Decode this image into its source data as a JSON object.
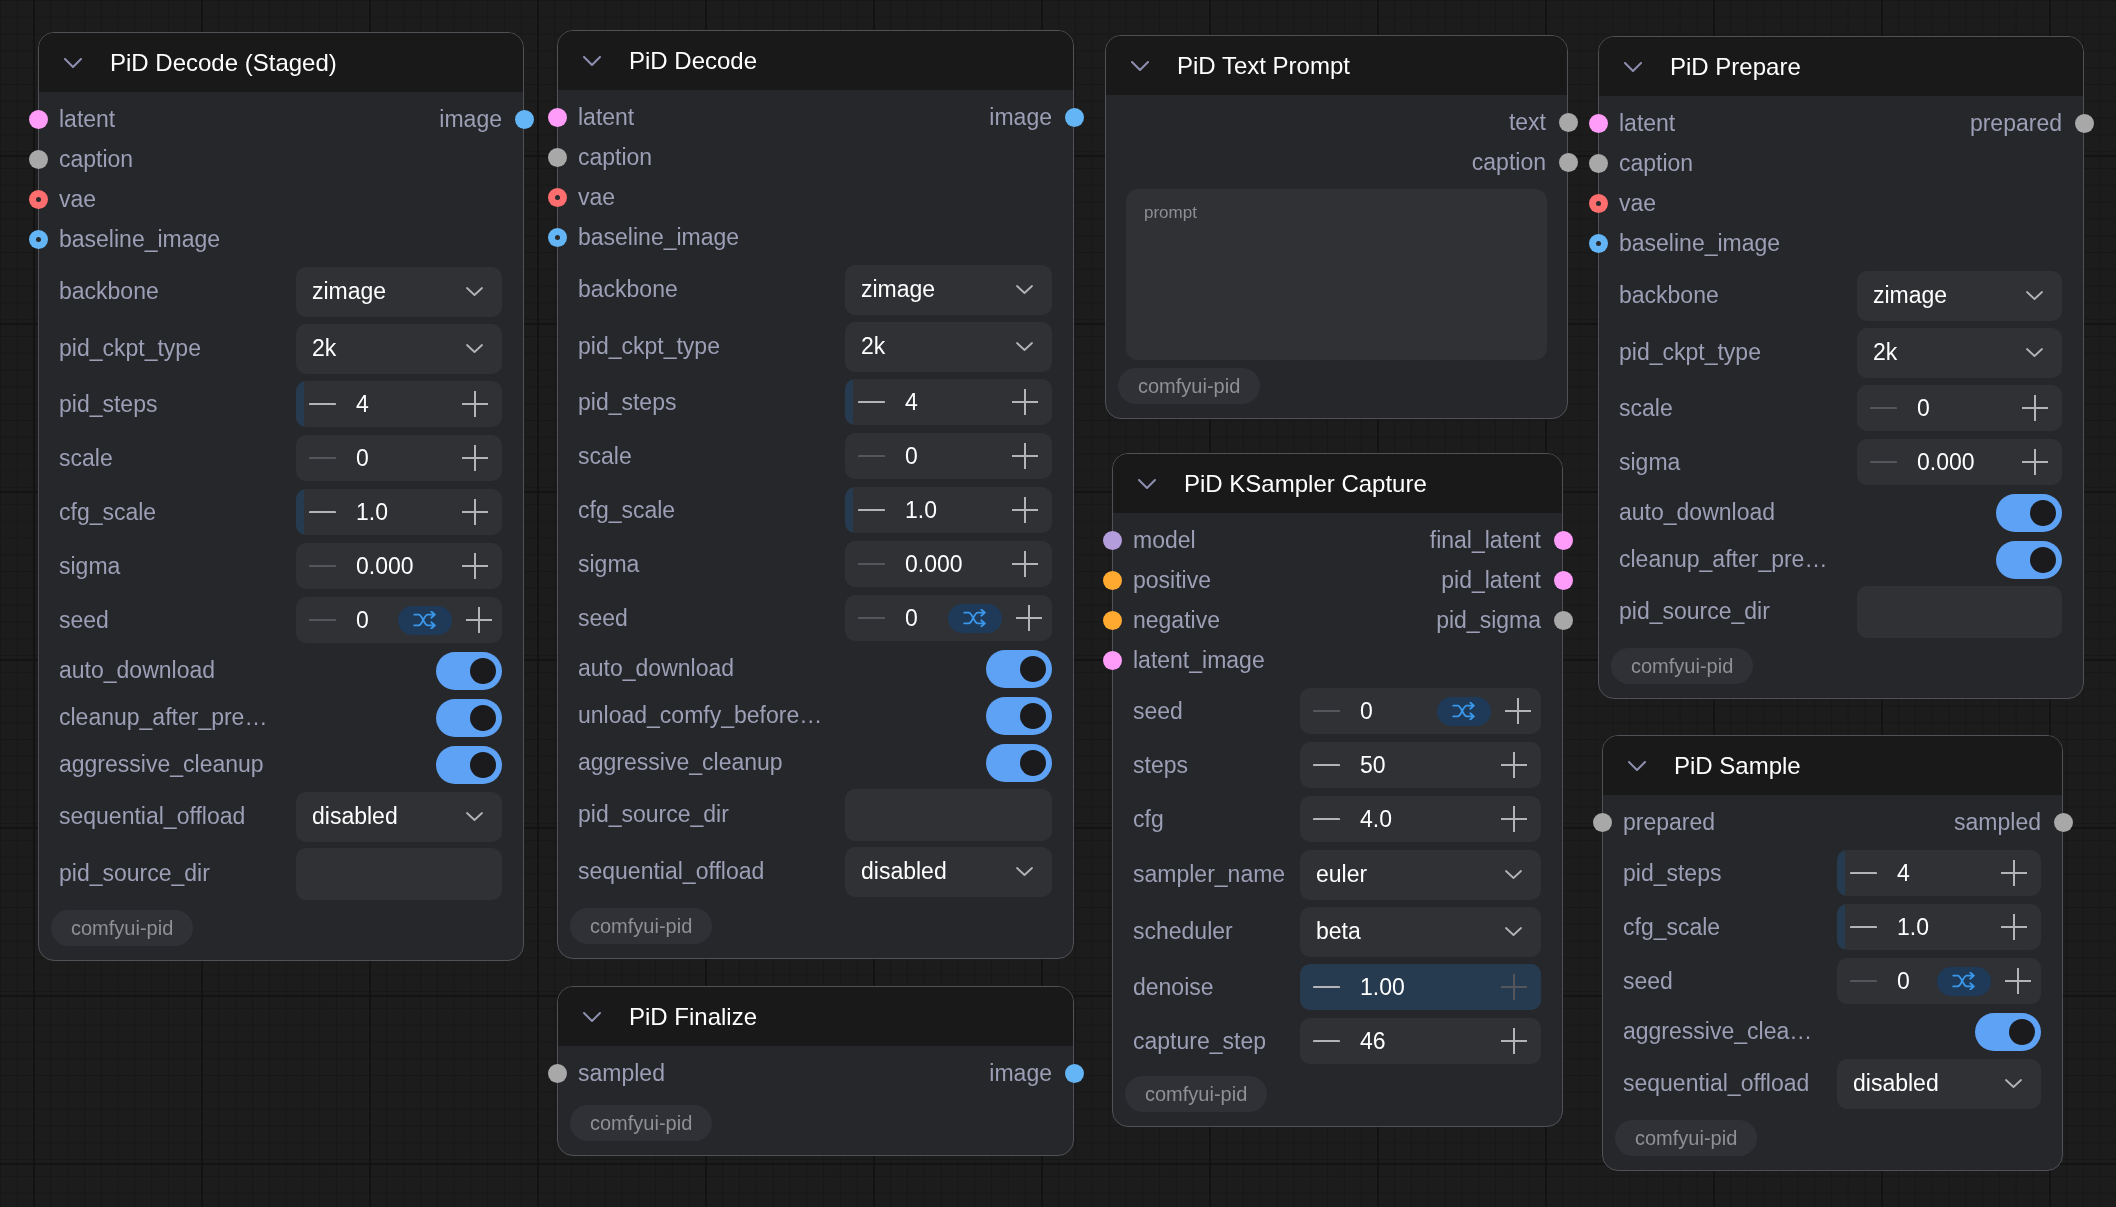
{
  "nodes": [
    {
      "title": "PiD Decode (Staged)",
      "inputs": [
        {
          "label": "latent",
          "color": "#ff9cf9",
          "center_dot": false
        },
        {
          "label": "caption",
          "color": "#a8a8a8",
          "center_dot": false
        },
        {
          "label": "vae",
          "color": "#ff6e6e",
          "center_dot": true
        },
        {
          "label": "baseline_image",
          "color": "#64b5f6",
          "center_dot": true
        }
      ],
      "outputs": [
        {
          "label": "image",
          "color": "#64b5f6"
        }
      ],
      "widgets": [
        {
          "kind": "combo",
          "label": "backbone",
          "value": "zimage"
        },
        {
          "kind": "combo",
          "label": "pid_ckpt_type",
          "value": "2k"
        },
        {
          "kind": "number",
          "label": "pid_steps",
          "value": "4",
          "level": 0.04,
          "dec_disabled": false,
          "inc_disabled": false,
          "randomize": false
        },
        {
          "kind": "number",
          "label": "scale",
          "value": "0",
          "dec_disabled": true,
          "inc_disabled": false,
          "randomize": false
        },
        {
          "kind": "number",
          "label": "cfg_scale",
          "value": "1.0",
          "level": 0.04,
          "dec_disabled": false,
          "inc_disabled": false,
          "randomize": false
        },
        {
          "kind": "number",
          "label": "sigma",
          "value": "0.000",
          "dec_disabled": true,
          "inc_disabled": false,
          "randomize": false
        },
        {
          "kind": "number",
          "label": "seed",
          "value": "0",
          "dec_disabled": true,
          "inc_disabled": false,
          "randomize": true
        },
        {
          "kind": "toggle",
          "label": "auto_download",
          "on": true
        },
        {
          "kind": "toggle",
          "label": "cleanup_after_pre…",
          "on": true
        },
        {
          "kind": "toggle",
          "label": "aggressive_cleanup",
          "on": true
        },
        {
          "kind": "combo",
          "label": "sequential_offload",
          "value": "disabled"
        },
        {
          "kind": "text",
          "label": "pid_source_dir"
        }
      ],
      "badge": "comfyui-pid"
    },
    {
      "title": "PiD Decode",
      "inputs": [
        {
          "label": "latent",
          "color": "#ff9cf9",
          "center_dot": false
        },
        {
          "label": "caption",
          "color": "#a8a8a8",
          "center_dot": false
        },
        {
          "label": "vae",
          "color": "#ff6e6e",
          "center_dot": true
        },
        {
          "label": "baseline_image",
          "color": "#64b5f6",
          "center_dot": true
        }
      ],
      "outputs": [
        {
          "label": "image",
          "color": "#64b5f6"
        }
      ],
      "widgets": [
        {
          "kind": "combo",
          "label": "backbone",
          "value": "zimage"
        },
        {
          "kind": "combo",
          "label": "pid_ckpt_type",
          "value": "2k"
        },
        {
          "kind": "number",
          "label": "pid_steps",
          "value": "4",
          "level": 0.04,
          "dec_disabled": false,
          "inc_disabled": false,
          "randomize": false
        },
        {
          "kind": "number",
          "label": "scale",
          "value": "0",
          "dec_disabled": true,
          "inc_disabled": false,
          "randomize": false
        },
        {
          "kind": "number",
          "label": "cfg_scale",
          "value": "1.0",
          "level": 0.04,
          "dec_disabled": false,
          "inc_disabled": false,
          "randomize": false
        },
        {
          "kind": "number",
          "label": "sigma",
          "value": "0.000",
          "dec_disabled": true,
          "inc_disabled": false,
          "randomize": false
        },
        {
          "kind": "number",
          "label": "seed",
          "value": "0",
          "dec_disabled": true,
          "inc_disabled": false,
          "randomize": true
        },
        {
          "kind": "toggle",
          "label": "auto_download",
          "on": true
        },
        {
          "kind": "toggle",
          "label": "unload_comfy_before…",
          "on": true
        },
        {
          "kind": "toggle",
          "label": "aggressive_cleanup",
          "on": true
        },
        {
          "kind": "text",
          "label": "pid_source_dir"
        },
        {
          "kind": "combo",
          "label": "sequential_offload",
          "value": "disabled"
        }
      ],
      "badge": "comfyui-pid"
    },
    {
      "title": "PiD Finalize",
      "inputs": [
        {
          "label": "sampled",
          "color": "#a8a8a8",
          "center_dot": false
        }
      ],
      "outputs": [
        {
          "label": "image",
          "color": "#64b5f6"
        }
      ],
      "badge": "comfyui-pid"
    },
    {
      "title": "PiD Text Prompt",
      "outputs": [
        {
          "label": "text",
          "color": "#a8a8a8"
        },
        {
          "label": "caption",
          "color": "#a8a8a8"
        }
      ],
      "widgets": [
        {
          "kind": "textarea",
          "placeholder": "prompt"
        }
      ],
      "badge": "comfyui-pid"
    },
    {
      "title": "PiD KSampler Capture",
      "inputs": [
        {
          "label": "model",
          "color": "#b39ddb",
          "center_dot": false
        },
        {
          "label": "positive",
          "color": "#ffa931",
          "center_dot": false
        },
        {
          "label": "negative",
          "color": "#ffa931",
          "center_dot": false
        },
        {
          "label": "latent_image",
          "color": "#ff9cf9",
          "center_dot": false
        }
      ],
      "outputs": [
        {
          "label": "final_latent",
          "color": "#ff9cf9"
        },
        {
          "label": "pid_latent",
          "color": "#ff9cf9"
        },
        {
          "label": "pid_sigma",
          "color": "#a8a8a8"
        }
      ],
      "widgets": [
        {
          "kind": "number",
          "label": "seed",
          "value": "0",
          "dec_disabled": true,
          "inc_disabled": false,
          "randomize": true
        },
        {
          "kind": "number",
          "label": "steps",
          "value": "50",
          "dec_disabled": false,
          "inc_disabled": false,
          "randomize": false
        },
        {
          "kind": "number",
          "label": "cfg",
          "value": "4.0",
          "dec_disabled": false,
          "inc_disabled": false,
          "randomize": false
        },
        {
          "kind": "combo",
          "label": "sampler_name",
          "value": "euler"
        },
        {
          "kind": "combo",
          "label": "scheduler",
          "value": "beta"
        },
        {
          "kind": "number",
          "label": "denoise",
          "value": "1.00",
          "level": 1,
          "dec_disabled": false,
          "inc_disabled": true,
          "randomize": false
        },
        {
          "kind": "number",
          "label": "capture_step",
          "value": "46",
          "dec_disabled": false,
          "inc_disabled": false,
          "randomize": false
        }
      ],
      "badge": "comfyui-pid"
    },
    {
      "title": "PiD Prepare",
      "inputs": [
        {
          "label": "latent",
          "color": "#ff9cf9",
          "center_dot": false
        },
        {
          "label": "caption",
          "color": "#a8a8a8",
          "center_dot": false
        },
        {
          "label": "vae",
          "color": "#ff6e6e",
          "center_dot": true
        },
        {
          "label": "baseline_image",
          "color": "#64b5f6",
          "center_dot": true
        }
      ],
      "outputs": [
        {
          "label": "prepared",
          "color": "#a8a8a8"
        }
      ],
      "widgets": [
        {
          "kind": "combo",
          "label": "backbone",
          "value": "zimage"
        },
        {
          "kind": "combo",
          "label": "pid_ckpt_type",
          "value": "2k"
        },
        {
          "kind": "number",
          "label": "scale",
          "value": "0",
          "dec_disabled": true,
          "inc_disabled": false,
          "randomize": false
        },
        {
          "kind": "number",
          "label": "sigma",
          "value": "0.000",
          "dec_disabled": true,
          "inc_disabled": false,
          "randomize": false
        },
        {
          "kind": "toggle",
          "label": "auto_download",
          "on": true
        },
        {
          "kind": "toggle",
          "label": "cleanup_after_pre…",
          "on": true
        },
        {
          "kind": "text",
          "label": "pid_source_dir"
        }
      ],
      "badge": "comfyui-pid"
    },
    {
      "title": "PiD Sample",
      "inputs": [
        {
          "label": "prepared",
          "color": "#a8a8a8",
          "center_dot": false
        }
      ],
      "outputs": [
        {
          "label": "sampled",
          "color": "#a8a8a8"
        }
      ],
      "widgets": [
        {
          "kind": "number",
          "label": "pid_steps",
          "value": "4",
          "level": 0.04,
          "dec_disabled": false,
          "inc_disabled": false,
          "randomize": false
        },
        {
          "kind": "number",
          "label": "cfg_scale",
          "value": "1.0",
          "level": 0.04,
          "dec_disabled": false,
          "inc_disabled": false,
          "randomize": false
        },
        {
          "kind": "number",
          "label": "seed",
          "value": "0",
          "dec_disabled": true,
          "inc_disabled": false,
          "randomize": true
        },
        {
          "kind": "toggle",
          "label": "aggressive_clea…",
          "on": true
        },
        {
          "kind": "combo",
          "label": "sequential_offload",
          "value": "disabled"
        }
      ],
      "badge": "comfyui-pid"
    }
  ]
}
